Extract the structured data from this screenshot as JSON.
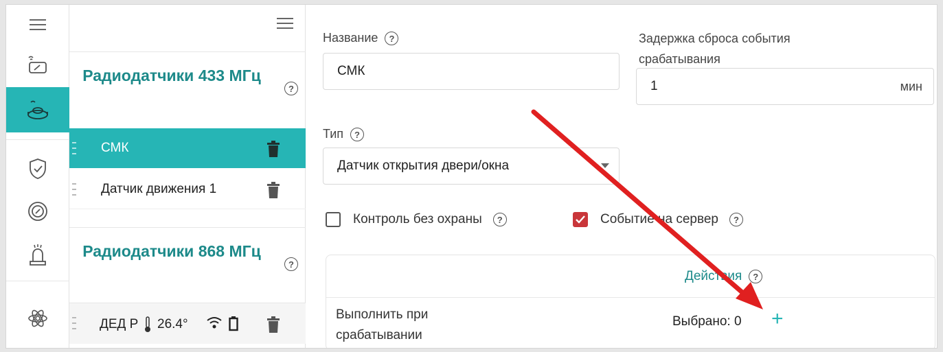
{
  "sidebar_groups": [
    {
      "title": "Радиодатчики 433 МГц",
      "items": [
        {
          "label": "СМК",
          "selected": true
        },
        {
          "label": "Датчик движения 1",
          "selected": false
        }
      ]
    },
    {
      "title": "Радиодатчики 868 МГц",
      "items": [
        {
          "label": "ДЕД Р",
          "temperature": "26.4°"
        }
      ]
    }
  ],
  "rail_icons": [
    "menu-icon",
    "remote-icon",
    "radio-sensor-icon",
    "shield-check-icon",
    "target-icon",
    "siren-icon",
    "settings-icon"
  ],
  "form": {
    "name_label": "Название",
    "name_value": "СМК",
    "delay_label_line1": "Задержка сброса события",
    "delay_label_line2": "срабатывания",
    "delay_value": "1",
    "delay_unit": "мин",
    "type_label": "Тип",
    "type_value": "Датчик открытия двери/окна",
    "checkbox_control_label": "Контроль без охраны",
    "checkbox_control_checked": false,
    "checkbox_server_label": "Событие на сервер",
    "checkbox_server_checked": true
  },
  "actions": {
    "title": "Действия",
    "row_label_line1": "Выполнить при",
    "row_label_line2": "срабатывании",
    "selected_text": "Выбрано: 0",
    "add_symbol": "+"
  },
  "help_symbol": "?",
  "colors": {
    "accent": "#26b5b5",
    "accent_text": "#1d8a8a",
    "checkbox_checked": "#c9363a",
    "annotation_arrow": "#e02020"
  }
}
